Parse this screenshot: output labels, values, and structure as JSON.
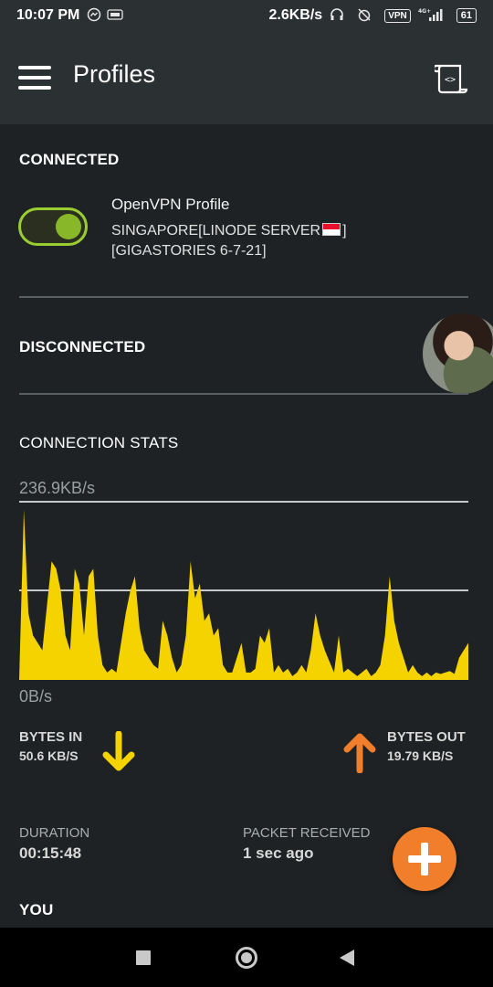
{
  "status_bar": {
    "time": "10:07 PM",
    "network_speed": "2.6KB/s",
    "vpn_label": "VPN",
    "network_type": "4G+",
    "battery": "61"
  },
  "app_bar": {
    "title": "Profiles"
  },
  "connected": {
    "heading": "CONNECTED",
    "profile_name": "OpenVPN Profile",
    "profile_detail_1": "SINGAPORE[LINODE SERVER",
    "profile_detail_1_end": "]",
    "profile_detail_2": "[GIGASTORIES 6-7-21]",
    "toggle_on": true
  },
  "disconnected": {
    "heading": "DISCONNECTED"
  },
  "stats": {
    "heading": "CONNECTION STATS",
    "max_label": "236.9KB/s",
    "min_label": "0B/s",
    "bytes_in_label": "BYTES IN",
    "bytes_in_value": "50.6 KB/S",
    "bytes_out_label": "BYTES OUT",
    "bytes_out_value": "19.79 KB/S",
    "duration_label": "DURATION",
    "duration_value": "00:15:48",
    "packet_label": "PACKET RECEIVED",
    "packet_value": "1 sec ago"
  },
  "you": {
    "heading": "YOU"
  },
  "colors": {
    "chart_fill": "#f5d300",
    "accent_green": "#9acd32",
    "fab": "#f07e2a",
    "arrow_in": "#f5d300",
    "arrow_out": "#f07e2a"
  },
  "chart_data": {
    "type": "area",
    "ylim": [
      0,
      236.9
    ],
    "unit": "KB/s",
    "values": [
      0,
      230,
      90,
      60,
      50,
      40,
      100,
      160,
      150,
      120,
      60,
      40,
      150,
      130,
      60,
      140,
      150,
      60,
      20,
      10,
      15,
      10,
      50,
      90,
      120,
      140,
      70,
      40,
      30,
      20,
      15,
      80,
      60,
      30,
      10,
      20,
      60,
      160,
      110,
      130,
      80,
      90,
      60,
      70,
      20,
      10,
      10,
      30,
      50,
      10,
      10,
      15,
      60,
      50,
      70,
      10,
      20,
      10,
      15,
      5,
      10,
      20,
      10,
      40,
      90,
      60,
      40,
      25,
      10,
      60,
      10,
      15,
      10,
      5,
      10,
      15,
      5,
      10,
      20,
      60,
      140,
      80,
      50,
      30,
      10,
      20,
      10,
      5,
      10,
      5,
      10,
      8,
      10,
      12,
      8,
      30,
      40,
      50
    ]
  }
}
